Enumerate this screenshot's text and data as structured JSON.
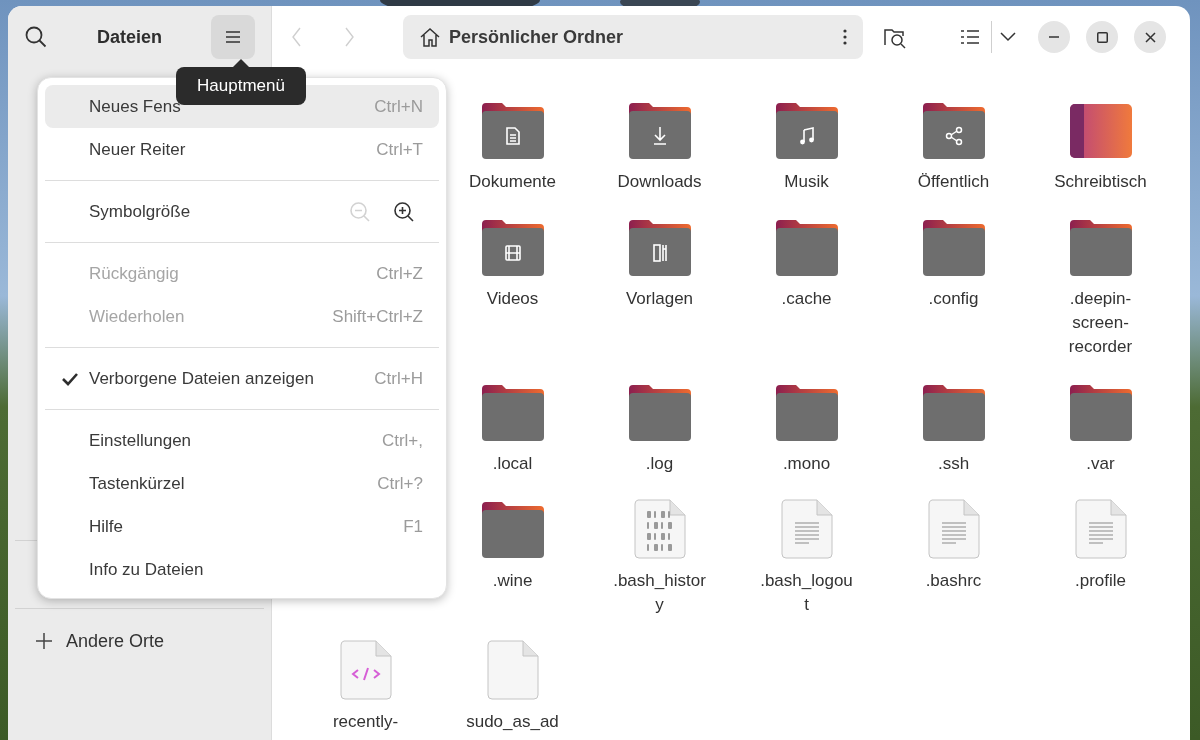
{
  "sidebar": {
    "title": "Dateien",
    "other_places": "Andere Orte"
  },
  "navigation": {
    "back": {
      "disabled": true
    },
    "forward": {
      "disabled": true
    }
  },
  "path_bar": {
    "location": "Persönlicher Ordner"
  },
  "tooltip": {
    "text": "Hauptmenü"
  },
  "main_menu": {
    "sections": [
      [
        {
          "kind": "item",
          "label": "Neues Fens",
          "shortcut": "Ctrl+N",
          "selected": true,
          "disabled": false
        },
        {
          "kind": "item",
          "label": "Neuer Reiter",
          "shortcut": "Ctrl+T",
          "selected": false,
          "disabled": false
        }
      ],
      [
        {
          "kind": "zoom",
          "label": "Symbolgröße",
          "selected": false,
          "disabled": false,
          "zoom_out": {
            "disabled": true
          },
          "zoom_in": {
            "disabled": false
          }
        }
      ],
      [
        {
          "kind": "item",
          "label": "Rückgängig",
          "shortcut": "Ctrl+Z",
          "selected": false,
          "disabled": true
        },
        {
          "kind": "item",
          "label": "Wiederholen",
          "shortcut": "Shift+Ctrl+Z",
          "selected": false,
          "disabled": true
        }
      ],
      [
        {
          "kind": "toggle",
          "label": "Verborgene Dateien anzeigen",
          "shortcut": "Ctrl+H",
          "selected": false,
          "disabled": false,
          "checked": true
        }
      ],
      [
        {
          "kind": "item",
          "label": "Einstellungen",
          "shortcut": "Ctrl+,",
          "selected": false,
          "disabled": false
        },
        {
          "kind": "item",
          "label": "Tastenkürzel",
          "shortcut": "Ctrl+?",
          "selected": false,
          "disabled": false
        },
        {
          "kind": "item",
          "label": "Hilfe",
          "shortcut": "F1",
          "selected": false,
          "disabled": false
        },
        {
          "kind": "item",
          "label": "Info zu Dateien",
          "selected": false,
          "disabled": false
        }
      ]
    ]
  },
  "files": {
    "rows": [
      [
        "",
        {
          "kind": "documents",
          "label": [
            "Dokumente"
          ]
        },
        {
          "kind": "downloads",
          "label": [
            "Downloads"
          ]
        },
        {
          "kind": "music",
          "label": [
            "Musik"
          ]
        },
        {
          "kind": "public",
          "label": [
            "Öffentlich"
          ]
        },
        {
          "kind": "desktop",
          "label": [
            "Schreibtisch"
          ]
        }
      ],
      [
        "",
        {
          "kind": "videos",
          "label": [
            "Videos"
          ]
        },
        {
          "kind": "templates",
          "label": [
            "Vorlagen"
          ]
        },
        {
          "kind": "folder",
          "label": [
            ".cache"
          ]
        },
        {
          "kind": "folder",
          "label": [
            ".config"
          ]
        },
        {
          "kind": "folder",
          "label": [
            ".deepin-",
            "screen-",
            "recorder"
          ]
        }
      ],
      [
        "",
        {
          "kind": "folder",
          "label": [
            ".local"
          ]
        },
        {
          "kind": "folder",
          "label": [
            ".log"
          ]
        },
        {
          "kind": "folder",
          "label": [
            ".mono"
          ]
        },
        {
          "kind": "folder",
          "label": [
            ".ssh"
          ]
        },
        {
          "kind": "folder",
          "label": [
            ".var"
          ]
        }
      ],
      [
        "",
        {
          "kind": "folder",
          "label": [
            ".wine"
          ]
        },
        {
          "kind": "binary",
          "label": [
            ".bash_histor",
            "y"
          ]
        },
        {
          "kind": "text",
          "label": [
            ".bash_logou",
            "t"
          ]
        },
        {
          "kind": "text",
          "label": [
            ".bashrc"
          ]
        },
        {
          "kind": "text",
          "label": [
            ".profile"
          ]
        }
      ],
      [
        {
          "kind": "code",
          "label": [
            "recently-"
          ]
        },
        {
          "kind": "blank",
          "label": [
            "sudo_as_ad"
          ]
        }
      ]
    ]
  }
}
